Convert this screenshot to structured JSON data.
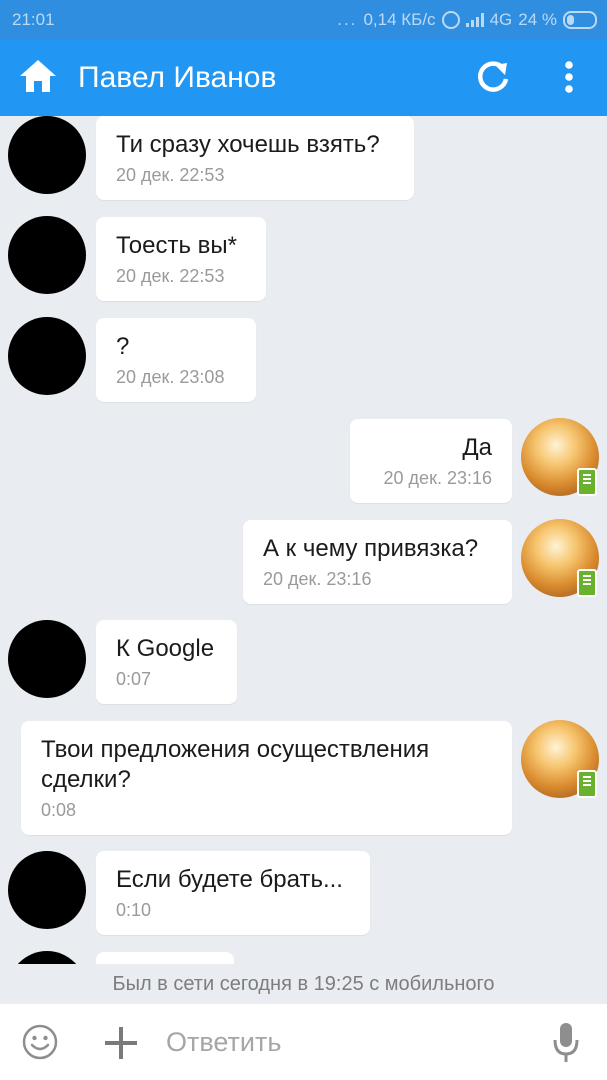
{
  "status_bar": {
    "time": "21:01",
    "dots": "...",
    "net_speed": "0,14 КБ/с",
    "network": "4G",
    "battery": "24 %"
  },
  "header": {
    "title": "Павел Иванов"
  },
  "messages": [
    {
      "dir": "in",
      "text": "Ти сразу хочешь взять?",
      "time": "20 дек. 22:53"
    },
    {
      "dir": "in",
      "text": "Тоесть вы*",
      "time": "20 дек. 22:53"
    },
    {
      "dir": "in",
      "text": "?",
      "time": "20 дек. 23:08"
    },
    {
      "dir": "out",
      "text": "Да",
      "time": "20 дек. 23:16"
    },
    {
      "dir": "out",
      "text": "А к чему привязка?",
      "time": "20 дек. 23:16"
    },
    {
      "dir": "in",
      "text": "К Google",
      "time": "0:07"
    },
    {
      "dir": "out",
      "text_line1": "Твои предложения осуществления",
      "text_line2": "сделки?",
      "time": "0:08"
    },
    {
      "dir": "in",
      "text": "Если будете брать...",
      "time": "0:10"
    }
  ],
  "last_seen": "Был в сети сегодня в 19:25 с мобильного",
  "composer": {
    "placeholder": "Ответить"
  },
  "colors": {
    "app_bar": "#2196f3",
    "status_bar": "#2f8ee0",
    "background": "#e9ecf0"
  }
}
